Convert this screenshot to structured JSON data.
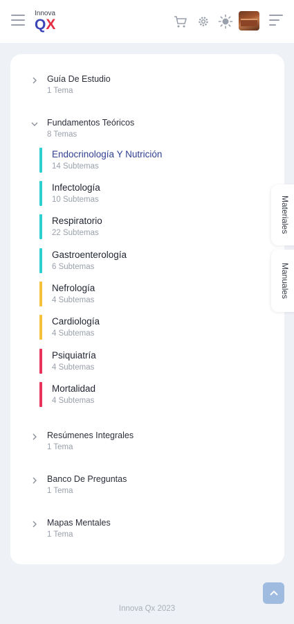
{
  "header": {
    "logo_small": "Innova",
    "logo_q": "Q",
    "logo_x": "X",
    "icons": [
      "menu-icon",
      "cart-icon",
      "gear-icon",
      "sun-icon",
      "avatar",
      "sort-icon"
    ]
  },
  "sections": [
    {
      "title": "Guía De Estudio",
      "sub": "1 Tema",
      "expanded": false
    },
    {
      "title": "Fundamentos Teóricos",
      "sub": "8 Temas",
      "expanded": true
    },
    {
      "title": "Resúmenes Integrales",
      "sub": "1 Tema",
      "expanded": false
    },
    {
      "title": "Banco De Preguntas",
      "sub": "1 Tema",
      "expanded": false
    },
    {
      "title": "Mapas Mentales",
      "sub": "1 Tema",
      "expanded": false
    }
  ],
  "topics": [
    {
      "title": "Endocrinología Y Nutrición",
      "sub": "14 Subtemas",
      "color": "#2ecfcf"
    },
    {
      "title": "Infectología",
      "sub": "10 Subtemas",
      "color": "#2ecfcf"
    },
    {
      "title": "Respiratorio",
      "sub": "22 Subtemas",
      "color": "#2ecfcf"
    },
    {
      "title": "Gastroenterología",
      "sub": "6 Subtemas",
      "color": "#2ecfcf"
    },
    {
      "title": "Nefrología",
      "sub": "4 Subtemas",
      "color": "#f5c13a"
    },
    {
      "title": "Cardiología",
      "sub": "4 Subtemas",
      "color": "#f5c13a"
    },
    {
      "title": "Psiquiatría",
      "sub": "4 Subtemas",
      "color": "#e8335a"
    },
    {
      "title": "Mortalidad",
      "sub": "4 Subtemas",
      "color": "#e8335a"
    }
  ],
  "side_tabs": {
    "materiales": "Materiales",
    "manuales": "Manuales"
  },
  "footer": "Innova Qx 2023",
  "colors": {
    "brand_blue": "#3c46b8",
    "brand_red": "#e52d42",
    "active_topic": "#2f3f8f"
  }
}
